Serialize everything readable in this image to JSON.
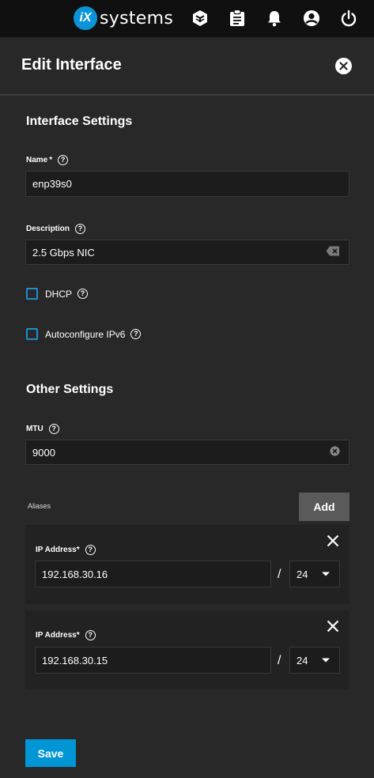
{
  "topbar": {
    "logo_mark": "iX",
    "logo_text": "systems",
    "icons": [
      "truecommand-icon",
      "tasks-clipboard-icon",
      "notifications-bell-icon",
      "account-circle-icon",
      "power-icon"
    ]
  },
  "header": {
    "title": "Edit Interface"
  },
  "interface_settings": {
    "title": "Interface Settings",
    "name": {
      "label": "Name",
      "required_mark": "*",
      "value": "enp39s0"
    },
    "description": {
      "label": "Description",
      "value": "2.5 Gbps NIC"
    },
    "dhcp": {
      "label": "DHCP",
      "checked": false
    },
    "autoconfigure_ipv6": {
      "label": "Autoconfigure IPv6",
      "checked": false
    }
  },
  "other_settings": {
    "title": "Other Settings",
    "mtu": {
      "label": "MTU",
      "value": "9000"
    }
  },
  "aliases": {
    "label": "Aliases",
    "add_label": "Add",
    "items": [
      {
        "label": "IP Address",
        "required_mark": "*",
        "address": "192.168.30.16",
        "separator": "/",
        "netmask": "24"
      },
      {
        "label": "IP Address",
        "required_mark": "*",
        "address": "192.168.30.15",
        "separator": "/",
        "netmask": "24"
      }
    ]
  },
  "save_label": "Save",
  "help_glyph": "?",
  "colors": {
    "accent": "#0095d5",
    "checkbox_border": "#1c8fd0",
    "background": "#282828",
    "topbar": "#101010"
  }
}
